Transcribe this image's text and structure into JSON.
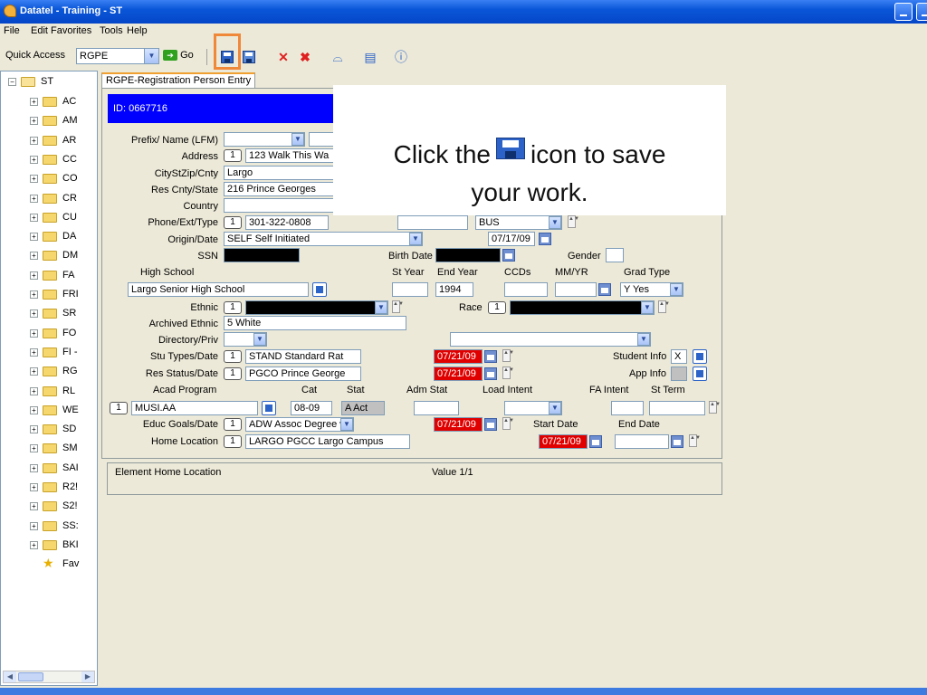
{
  "window": {
    "title": "Datatel - Training - ST"
  },
  "menu": [
    "File",
    "Edit",
    "Favorites",
    "Tools",
    "Help"
  ],
  "toolbar": {
    "quick_access_label": "Quick Access",
    "quick_access_value": "RGPE",
    "go_label": "Go"
  },
  "tree": {
    "root": "ST",
    "items": [
      "AC",
      "AM",
      "AR",
      "CC",
      "CO",
      "CR",
      "CU",
      "DA",
      "DM",
      "FA",
      "FRI",
      "SR",
      "FO",
      "FI -",
      "RG",
      "RL",
      "WE",
      "SD",
      "SM",
      "SAI",
      "R2!",
      "S2!",
      "SS:",
      "BKI",
      "Fav"
    ]
  },
  "tab": {
    "label": "RGPE-Registration Person Entry"
  },
  "form": {
    "id_text": "ID: 0667716",
    "labels": {
      "prefix_name": "Prefix/ Name (LFM)",
      "address": "Address",
      "city_st_zip": "CityStZip/Cnty",
      "res_cnty_state": "Res Cnty/State",
      "country": "Country",
      "phone": "Phone/Ext/Type",
      "origin_date": "Origin/Date",
      "ssn": "SSN",
      "birth_date": "Birth Date",
      "gender": "Gender",
      "high_school": "High School",
      "st_year": "St Year",
      "end_year": "End Year",
      "ccds": "CCDs",
      "mm_yr": "MM/YR",
      "grad_type": "Grad Type",
      "ethnic": "Ethnic",
      "race": "Race",
      "archived_ethnic": "Archived Ethnic",
      "directory_priv": "Directory/Priv",
      "stu_types_date": "Stu Types/Date",
      "student_info": "Student Info",
      "res_status_date": "Res Status/Date",
      "app_info": "App Info",
      "acad_program": "Acad Program",
      "cat": "Cat",
      "stat": "Stat",
      "adm_stat": "Adm Stat",
      "load_intent": "Load Intent",
      "fa_intent": "FA Intent",
      "st_term": "St Term",
      "educ_goals_date": "Educ Goals/Date",
      "start_date": "Start Date",
      "end_date": "End Date",
      "home_location": "Home Location"
    },
    "values": {
      "address": "123 Walk This Wa",
      "city": "Largo",
      "res_cnty": "216 Prince Georges",
      "phone": "301-322-0808",
      "phone_type": "BUS",
      "origin": "SELF Self Initiated",
      "origin_date": "07/17/09",
      "high_school": "Largo Senior High School",
      "end_year": "1994",
      "grad_type": "Y Yes",
      "archived_ethnic": "5 White",
      "stu_type": "STAND Standard Rat",
      "stu_type_date": "07/21/09",
      "student_info": "X",
      "res_status": "PGCO Prince George",
      "res_status_date": "07/21/09",
      "acad_program": "MUSI.AA",
      "cat": "08-09",
      "stat": "A Act",
      "educ_goal": "ADW Assoc Degree w",
      "educ_goal_date": "07/21/09",
      "start_date": "07/21/09",
      "home_location": "LARGO PGCC Largo Campus"
    },
    "num_badge": "1"
  },
  "element_bar": {
    "label": "Element Home Location",
    "value": "Value 1/1"
  },
  "callout": {
    "line1_pre": "Click the",
    "line1_post": "icon to save",
    "line2": "your work."
  },
  "colors": {
    "highlight": "#f0883a",
    "id_bar": "#0000ff",
    "required_date": "#e00000"
  }
}
